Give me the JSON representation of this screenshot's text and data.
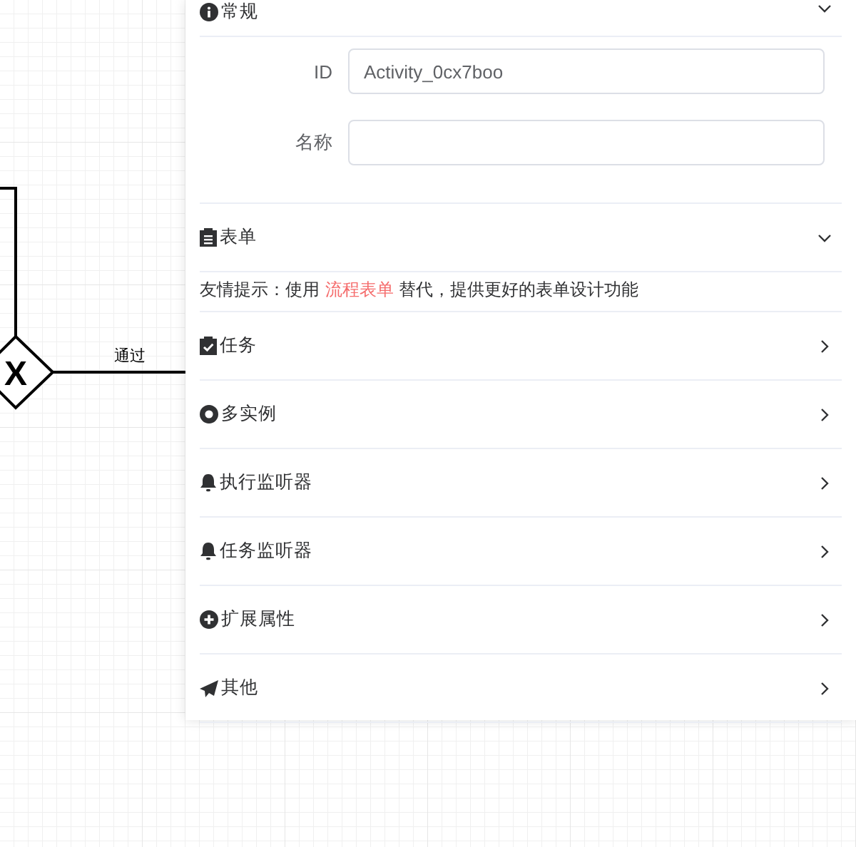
{
  "diagram": {
    "flow_label": "通过",
    "gateway_symbol": "X"
  },
  "panel": {
    "general": {
      "title": "常规",
      "kind": "info",
      "expanded": true,
      "fields": [
        {
          "label": "ID",
          "value": "Activity_0cx7boo"
        },
        {
          "label": "名称"
        }
      ]
    },
    "form": {
      "title": "表单",
      "kind": "clipboard",
      "expanded": true,
      "hint_before": "友情提示：使用 ",
      "hint_link": "流程表单",
      "hint_after": " 替代，提供更好的表单设计功能"
    },
    "sections": [
      {
        "title": "任务",
        "kind": "task",
        "expanded": false
      },
      {
        "title": "多实例",
        "kind": "multi",
        "expanded": false
      },
      {
        "title": "执行监听器",
        "kind": "listener",
        "expanded": false
      },
      {
        "title": "任务监听器",
        "kind": "listener",
        "expanded": false
      },
      {
        "title": "扩展属性",
        "kind": "extension",
        "expanded": false
      },
      {
        "title": "其他",
        "kind": "other",
        "expanded": false
      }
    ]
  }
}
